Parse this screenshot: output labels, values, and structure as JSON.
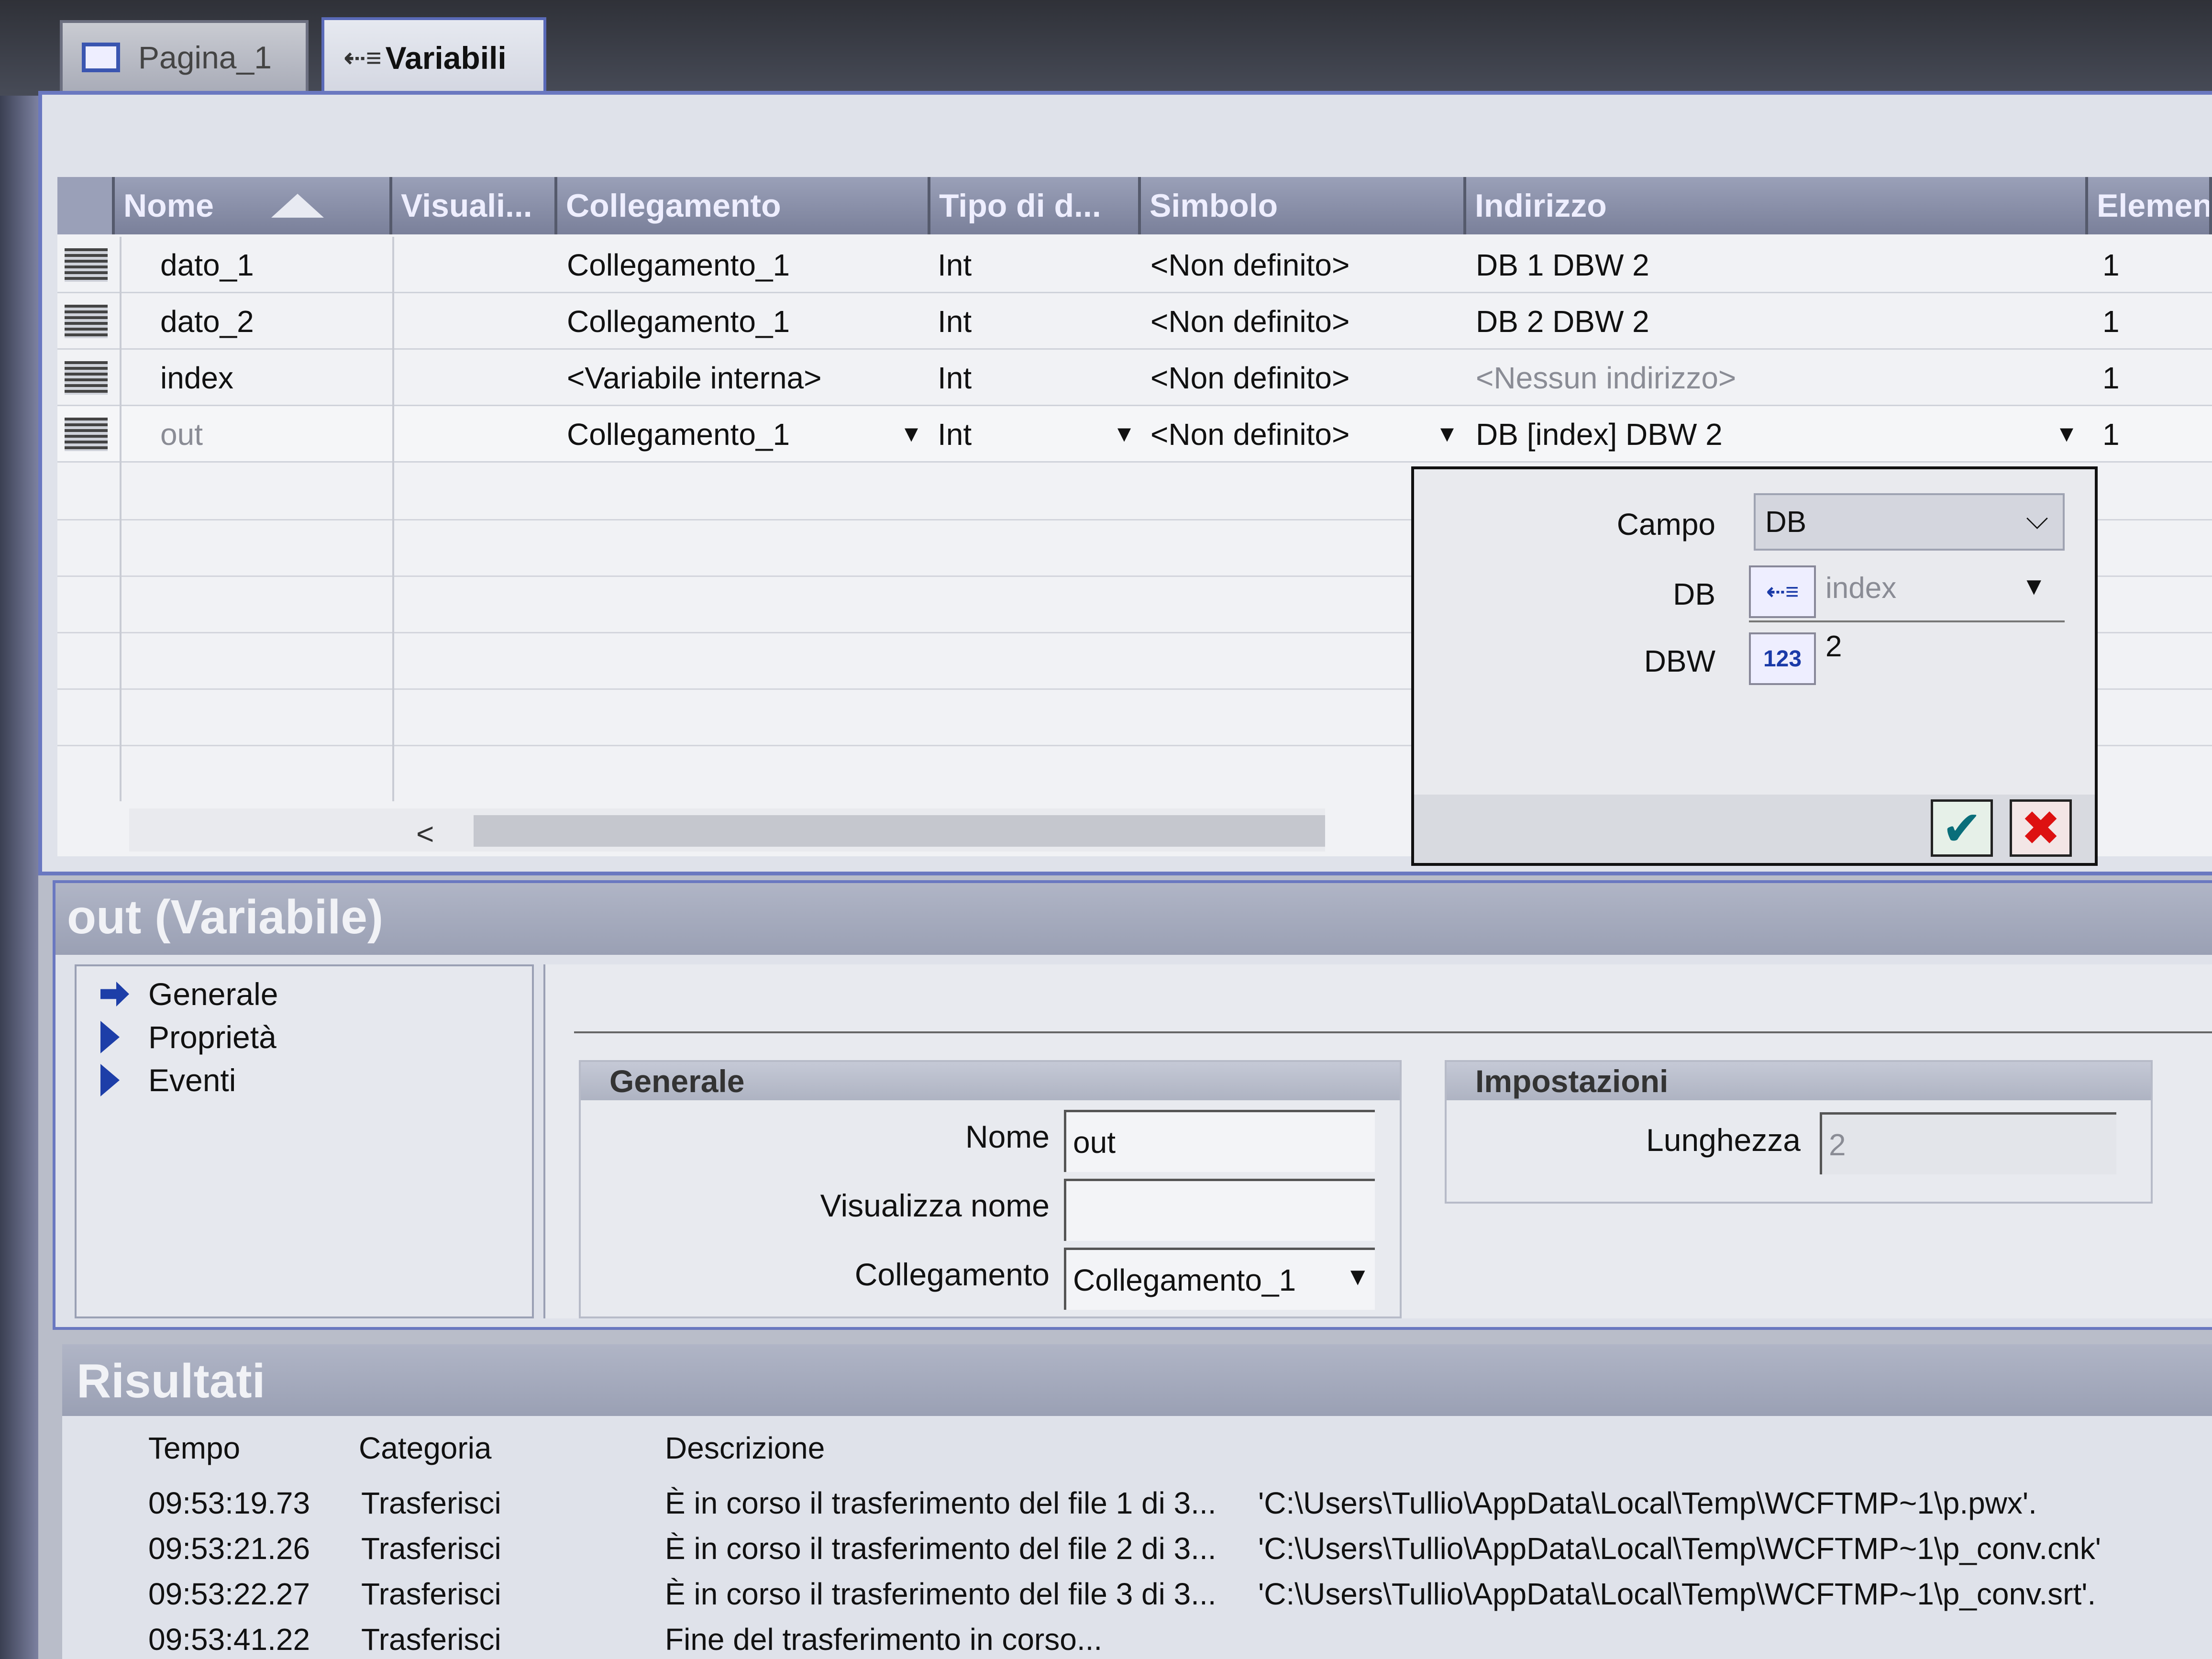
{
  "tabs": [
    {
      "label": "Pagina_1",
      "icon": "page-icon"
    },
    {
      "label": "Variabili",
      "icon": "variables-icon"
    }
  ],
  "grid": {
    "columns": [
      "Nome",
      "Visuali...",
      "Collegamento",
      "Tipo di d...",
      "Simbolo",
      "Indirizzo",
      "Elementi"
    ],
    "rows": [
      {
        "nome": "dato_1",
        "visuali": "",
        "collegamento": "Collegamento_1",
        "tipo": "Int",
        "simbolo": "<Non definito>",
        "indirizzo": "DB 1 DBW 2",
        "elementi": "1"
      },
      {
        "nome": "dato_2",
        "visuali": "",
        "collegamento": "Collegamento_1",
        "tipo": "Int",
        "simbolo": "<Non definito>",
        "indirizzo": "DB 2 DBW 2",
        "elementi": "1"
      },
      {
        "nome": "index",
        "visuali": "",
        "collegamento": "<Variabile interna>",
        "tipo": "Int",
        "simbolo": "<Non definito>",
        "indirizzo": "<Nessun indirizzo>",
        "elementi": "1"
      },
      {
        "nome": "out",
        "visuali": "",
        "collegamento": "Collegamento_1",
        "tipo": "Int",
        "simbolo": "<Non definito>",
        "indirizzo": "DB [index] DBW 2",
        "elementi": "1"
      }
    ],
    "scroll_left": "<"
  },
  "popup": {
    "campo_label": "Campo",
    "campo_value": "DB",
    "db_label": "DB",
    "db_value": "index",
    "dbw_label": "DBW",
    "dbw_icon": "123",
    "dbw_value": "2"
  },
  "props": {
    "title": "out (Variabile)",
    "nav": [
      "Generale",
      "Proprietà",
      "Eventi"
    ],
    "generale": {
      "title": "Generale",
      "nome_label": "Nome",
      "nome_value": "out",
      "visualizza_label": "Visualizza nome",
      "visualizza_value": "",
      "collegamento_label": "Collegamento",
      "collegamento_value": "Collegamento_1"
    },
    "impostazioni": {
      "title": "Impostazioni",
      "lunghezza_label": "Lunghezza",
      "lunghezza_value": "2"
    }
  },
  "results": {
    "title": "Risultati",
    "headers": [
      "Tempo",
      "Categoria",
      "Descrizione"
    ],
    "rows": [
      {
        "tempo": "09:53:19.73",
        "categoria": "Trasferisci",
        "descrizione": "È in corso il trasferimento del file 1 di 3...",
        "path": "'C:\\Users\\Tullio\\AppData\\Local\\Temp\\WCFTMP~1\\p.pwx'."
      },
      {
        "tempo": "09:53:21.26",
        "categoria": "Trasferisci",
        "descrizione": "È in corso il trasferimento del file 2 di 3...",
        "path": "'C:\\Users\\Tullio\\AppData\\Local\\Temp\\WCFTMP~1\\p_conv.cnk'"
      },
      {
        "tempo": "09:53:22.27",
        "categoria": "Trasferisci",
        "descrizione": "È in corso il trasferimento del file 3 di 3...",
        "path": "'C:\\Users\\Tullio\\AppData\\Local\\Temp\\WCFTMP~1\\p_conv.srt'."
      },
      {
        "tempo": "09:53:41.22",
        "categoria": "Trasferisci",
        "descrizione": "Fine del trasferimento in corso...",
        "path": ""
      }
    ]
  }
}
